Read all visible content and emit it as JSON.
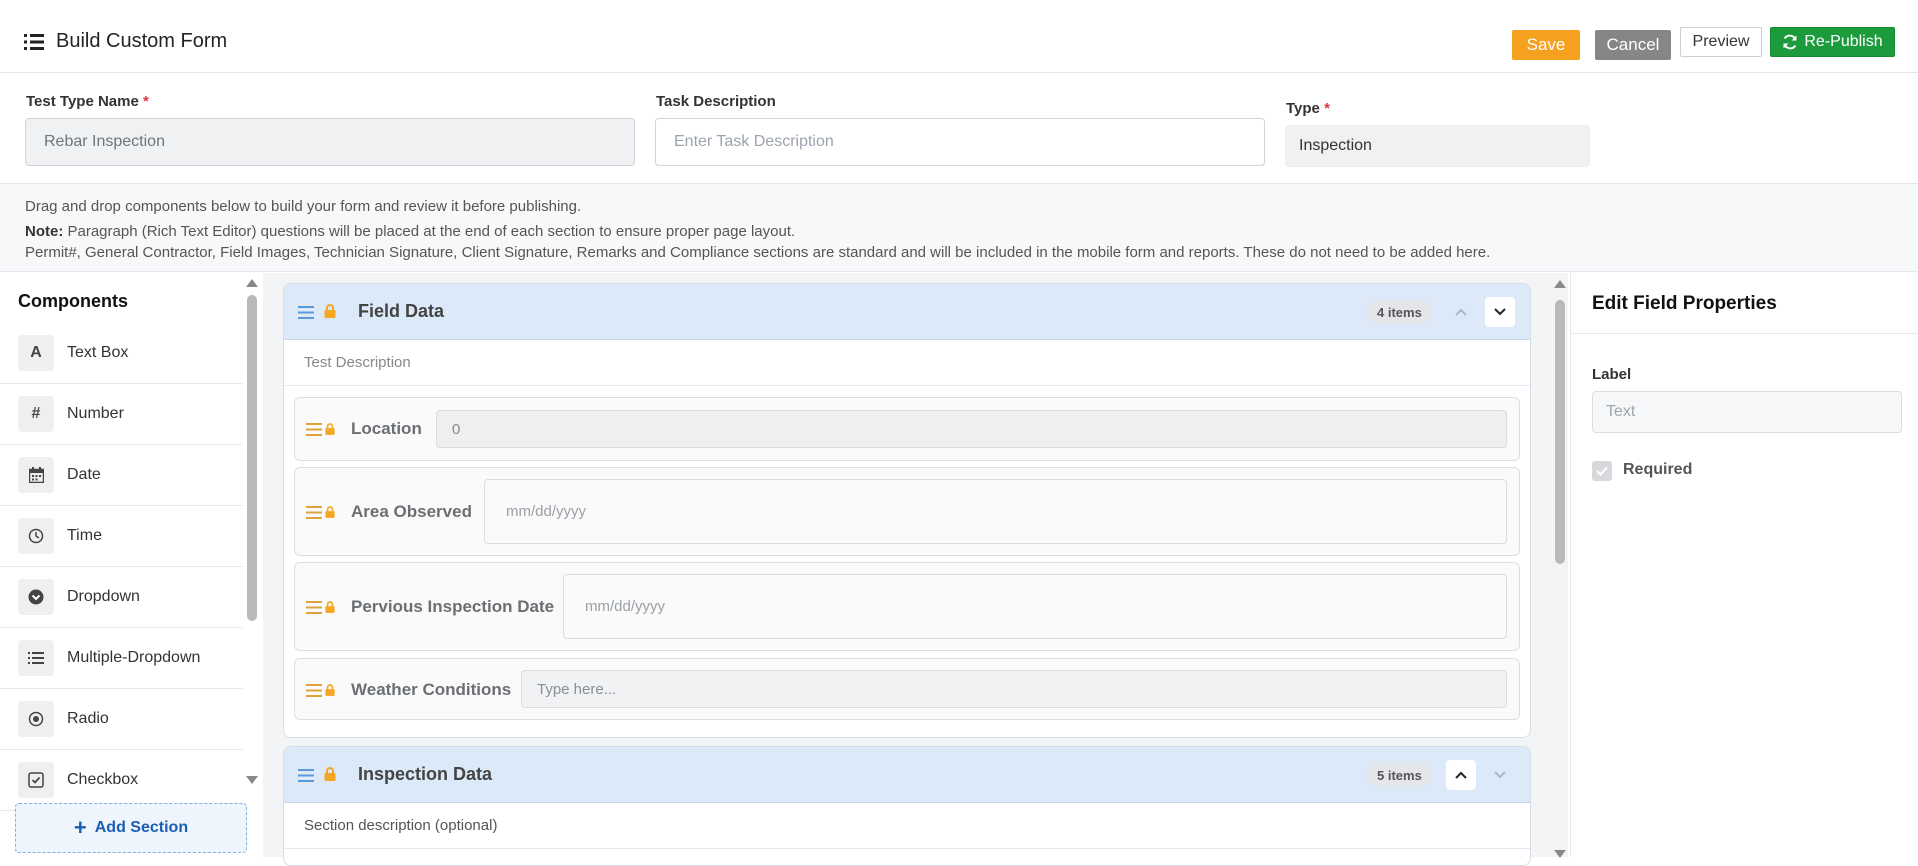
{
  "header": {
    "title": "Build Custom Form",
    "buttons": {
      "save": "Save",
      "cancel": "Cancel",
      "preview": "Preview",
      "republish": "Re-Publish"
    }
  },
  "form_fields": {
    "test_type_name": {
      "label": "Test Type Name",
      "required_mark": "*",
      "value": "Rebar Inspection"
    },
    "task_description": {
      "label": "Task Description",
      "placeholder": "Enter Task Description"
    },
    "type": {
      "label": "Type",
      "required_mark": "*",
      "value": "Inspection"
    }
  },
  "info": {
    "line1": "Drag and drop components below to build your form and review it before publishing.",
    "note_label": "Note:",
    "note_text": " Paragraph (Rich Text Editor) questions will be placed at the end of each section to ensure proper page layout.",
    "line3": "Permit#, General Contractor, Field Images, Technician Signature, Client Signature, Remarks and Compliance sections are standard and will be included in the mobile form and reports. These do not need to be added here."
  },
  "components": {
    "title": "Components",
    "items": [
      {
        "label": "Text Box",
        "icon": "text-icon"
      },
      {
        "label": "Number",
        "icon": "hash-icon"
      },
      {
        "label": "Date",
        "icon": "calendar-icon"
      },
      {
        "label": "Time",
        "icon": "clock-icon"
      },
      {
        "label": "Dropdown",
        "icon": "chevron-circle-icon"
      },
      {
        "label": "Multiple-Dropdown",
        "icon": "list-icon"
      },
      {
        "label": "Radio",
        "icon": "radio-icon"
      },
      {
        "label": "Checkbox",
        "icon": "checkbox-icon"
      }
    ],
    "add_section": "Add Section"
  },
  "sections": [
    {
      "title": "Field Data",
      "items_count": "4 items",
      "description": "Test Description",
      "questions": [
        {
          "label": "Location",
          "value": "0"
        },
        {
          "label": "Area Observed",
          "placeholder": "mm/dd/yyyy"
        },
        {
          "label": "Pervious Inspection Date",
          "placeholder": "mm/dd/yyyy"
        },
        {
          "label": "Weather Conditions",
          "placeholder": "Type here..."
        }
      ]
    },
    {
      "title": "Inspection Data",
      "items_count": "5 items",
      "description": "Section description (optional)"
    }
  ],
  "properties": {
    "title": "Edit Field Properties",
    "label_caption": "Label",
    "label_placeholder": "Text",
    "required_label": "Required"
  },
  "colors": {
    "save": "#f5a01e",
    "cancel": "#868686",
    "republish": "#1c9b3c",
    "section_header": "#dbe9f8",
    "drag_handle_blue": "#5b9bd5",
    "lock": "#f5a623",
    "drag_handle_gold": "#e2a23b"
  }
}
